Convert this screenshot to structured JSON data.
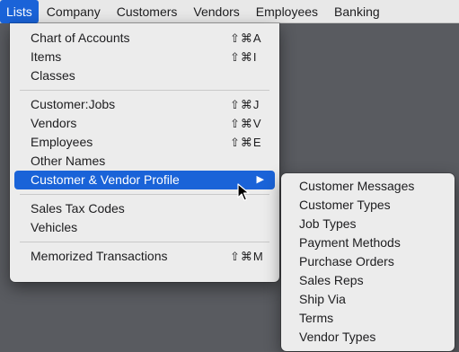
{
  "menubar": {
    "items": [
      {
        "label": "Lists"
      },
      {
        "label": "Company"
      },
      {
        "label": "Customers"
      },
      {
        "label": "Vendors"
      },
      {
        "label": "Employees"
      },
      {
        "label": "Banking"
      }
    ]
  },
  "lists_menu": {
    "chart_of_accounts": {
      "label": "Chart of Accounts",
      "shortcut": "⇧⌘A"
    },
    "items": {
      "label": "Items",
      "shortcut": "⇧⌘I"
    },
    "classes": {
      "label": "Classes"
    },
    "customer_jobs": {
      "label": "Customer:Jobs",
      "shortcut": "⇧⌘J"
    },
    "vendors": {
      "label": "Vendors",
      "shortcut": "⇧⌘V"
    },
    "employees": {
      "label": "Employees",
      "shortcut": "⇧⌘E"
    },
    "other_names": {
      "label": "Other Names"
    },
    "customer_vendor_profile": {
      "label": "Customer & Vendor Profile",
      "arrow": "▶"
    },
    "sales_tax_codes": {
      "label": "Sales Tax Codes"
    },
    "vehicles": {
      "label": "Vehicles"
    },
    "memorized_transactions": {
      "label": "Memorized Transactions",
      "shortcut": "⇧⌘M"
    }
  },
  "submenu": {
    "items": [
      {
        "label": "Customer Messages"
      },
      {
        "label": "Customer Types"
      },
      {
        "label": "Job Types"
      },
      {
        "label": "Payment Methods"
      },
      {
        "label": "Purchase Orders"
      },
      {
        "label": "Sales Reps"
      },
      {
        "label": "Ship Via"
      },
      {
        "label": "Terms"
      },
      {
        "label": "Vendor Types"
      }
    ]
  }
}
